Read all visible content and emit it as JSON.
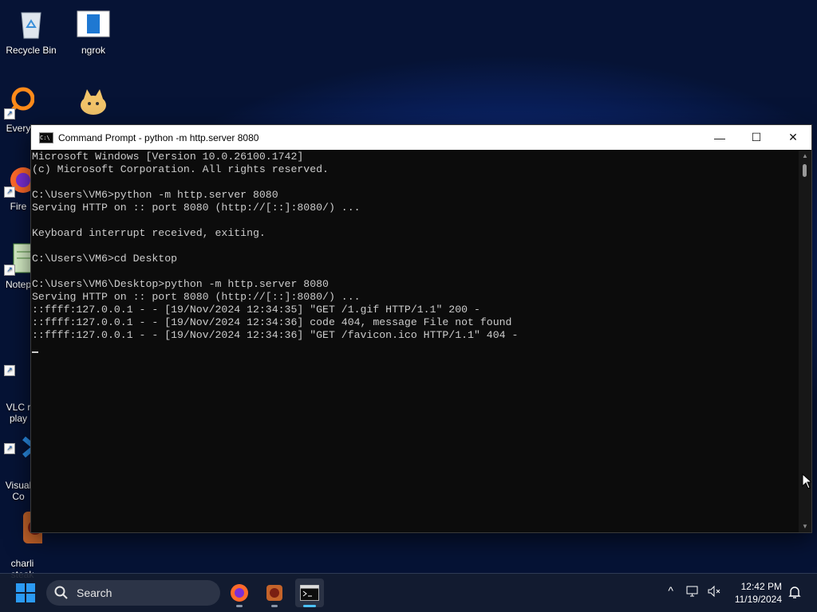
{
  "desktop": {
    "icons": [
      {
        "label": "Recycle Bin",
        "icon": "recycle-bin-icon"
      },
      {
        "label": "ngrok",
        "icon": "ngrok-icon"
      },
      {
        "label": "Every",
        "icon": "everything-search-icon"
      },
      {
        "label": "",
        "icon": "cat-app-icon"
      },
      {
        "label": "Fire",
        "icon": "firefox-icon"
      },
      {
        "label": "Notep",
        "icon": "notepad-icon"
      },
      {
        "label": "VLC r\nplay",
        "icon": "vlc-icon"
      },
      {
        "label": "Visual\nCo",
        "icon": "vscode-icon"
      },
      {
        "label": "charli\nsteak",
        "icon": "charlie-steak-icon"
      }
    ]
  },
  "window": {
    "title": "Command Prompt - python  -m http.server 8080",
    "icon_text": "C:\\",
    "minimize_glyph": "—",
    "maximize_glyph": "☐",
    "close_glyph": "✕"
  },
  "console": {
    "lines": [
      "Microsoft Windows [Version 10.0.26100.1742]",
      "(c) Microsoft Corporation. All rights reserved.",
      "",
      "C:\\Users\\VM6>python -m http.server 8080",
      "Serving HTTP on :: port 8080 (http://[::]:8080/) ...",
      "",
      "Keyboard interrupt received, exiting.",
      "",
      "C:\\Users\\VM6>cd Desktop",
      "",
      "C:\\Users\\VM6\\Desktop>python -m http.server 8080",
      "Serving HTTP on :: port 8080 (http://[::]:8080/) ...",
      "::ffff:127.0.0.1 - - [19/Nov/2024 12:34:35] \"GET /1.gif HTTP/1.1\" 200 -",
      "::ffff:127.0.0.1 - - [19/Nov/2024 12:34:36] code 404, message File not found",
      "::ffff:127.0.0.1 - - [19/Nov/2024 12:34:36] \"GET /favicon.ico HTTP/1.1\" 404 -"
    ]
  },
  "taskbar": {
    "search_label": "Search",
    "apps": [
      "firefox-icon",
      "charlie-steak-icon",
      "command-prompt-icon"
    ],
    "tray": {
      "chevron": "^",
      "time": "12:42 PM",
      "date": "11/19/2024"
    }
  },
  "colors": {
    "accent": "#4cc2ff",
    "console_bg": "#0c0c0c",
    "console_text": "#cccccc"
  }
}
